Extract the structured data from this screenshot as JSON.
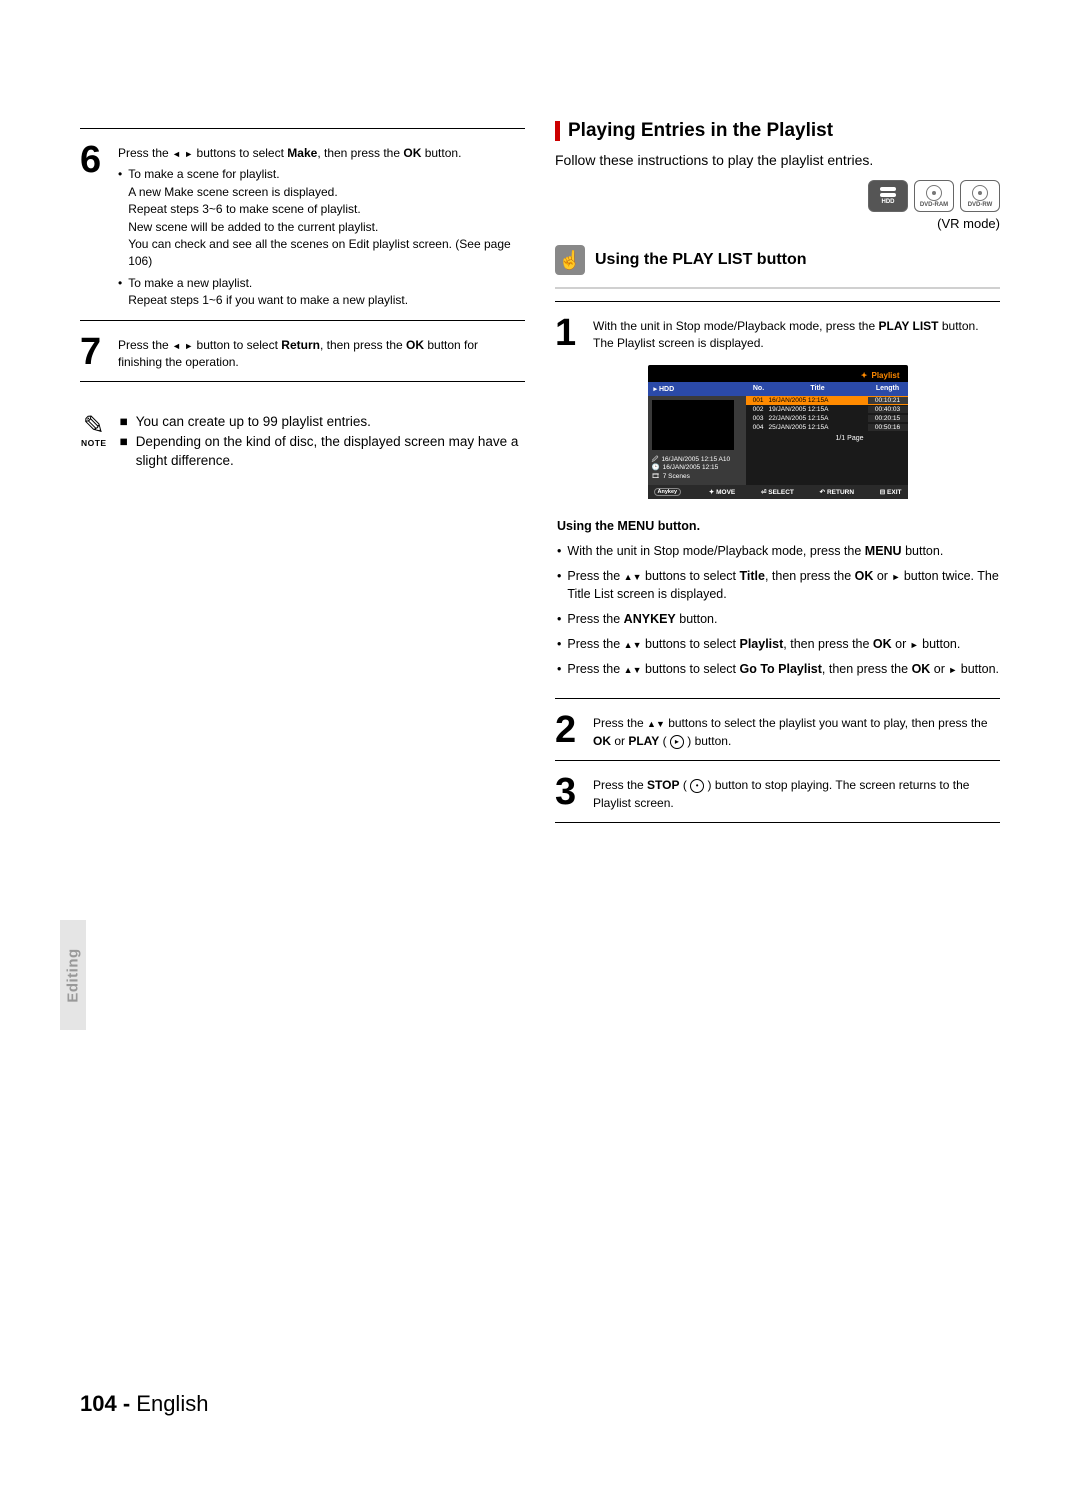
{
  "left": {
    "step6": {
      "num": "6",
      "text_parts": [
        "Press the ",
        " ",
        " buttons to select ",
        "Make",
        ", then press the ",
        "OK",
        " button."
      ],
      "bullet1_lines": [
        "To make a scene for playlist.",
        "A new Make scene screen is displayed.",
        "Repeat steps 3~6 to make scene of playlist.",
        "New scene will be added to the current playlist.",
        "You can check and see all the scenes on Edit playlist screen. (See page 106)"
      ],
      "bullet2_lines": [
        "To make a new playlist.",
        "Repeat steps 1~6 if you want to make a new playlist."
      ]
    },
    "step7": {
      "num": "7",
      "text_parts": [
        "Press the ",
        " ",
        " button to select ",
        "Return",
        ", then press the ",
        "OK",
        " button for finishing the operation."
      ]
    },
    "note": {
      "label": "NOTE",
      "items": [
        "You can create up to 99 playlist entries.",
        "Depending on the kind of disc, the displayed screen may have a slight difference."
      ]
    }
  },
  "right": {
    "title": "Playing Entries in the Playlist",
    "intro": "Follow these instructions to play the playlist entries.",
    "media": {
      "hdd": "HDD",
      "ram": "DVD-RAM",
      "rw": "DVD-RW"
    },
    "vr_mode": "(VR mode)",
    "subhead": "Using the PLAY LIST button",
    "step1": {
      "num": "1",
      "line1_parts": [
        "With the unit in Stop mode/Playback mode, press the ",
        "PLAY LIST",
        " button."
      ],
      "line2": "The Playlist screen is displayed."
    },
    "osd": {
      "title": "Playlist",
      "left_label": "HDD",
      "cols": {
        "no": "No.",
        "title": "Title",
        "length": "Length"
      },
      "rows": [
        {
          "no": "001",
          "title": "16/JAN/2005 12:15A",
          "length": "00:10:21"
        },
        {
          "no": "002",
          "title": "19/JAN/2005 12:15A",
          "length": "00:40:03"
        },
        {
          "no": "003",
          "title": "22/JAN/2005 12:15A",
          "length": "00:20:15"
        },
        {
          "no": "004",
          "title": "25/JAN/2005 12:15A",
          "length": "00:50:16"
        }
      ],
      "meta1": "16/JAN/2005 12:15 A10",
      "meta2": "16/JAN/2005 12:15",
      "meta3": "7 Scenes",
      "page": "1/1  Page",
      "footer": {
        "anykey": "Anykey",
        "move": "MOVE",
        "select": "SELECT",
        "return": "RETURN",
        "exit": "EXIT"
      }
    },
    "menu": {
      "head": "Using the MENU button.",
      "b1": [
        "With the unit in Stop mode/Playback mode, press the ",
        "MENU",
        " button."
      ],
      "b2": [
        "Press the ",
        " buttons to select ",
        "Title",
        ", then press the ",
        "OK",
        " or ",
        " button twice. The Title List screen is displayed."
      ],
      "b3": [
        "Press the ",
        "ANYKEY",
        " button."
      ],
      "b4": [
        "Press the ",
        " buttons to select ",
        "Playlist",
        ", then press the ",
        "OK",
        " or ",
        " button."
      ],
      "b5": [
        "Press the ",
        " buttons to select ",
        "Go To Playlist",
        ", then press the ",
        "OK",
        " or ",
        " button."
      ]
    },
    "step2": {
      "num": "2",
      "parts": [
        "Press the ",
        " buttons to select the playlist you want to play, then press the ",
        "OK",
        " or ",
        "PLAY",
        " ( ",
        " ) button."
      ]
    },
    "step3": {
      "num": "3",
      "parts": [
        "Press the ",
        "STOP",
        " ( ",
        " )  button to stop playing. The screen returns to the Playlist screen."
      ]
    }
  },
  "chart_data": {
    "type": "table",
    "title": "Playlist",
    "columns": [
      "No.",
      "Title",
      "Length"
    ],
    "rows": [
      [
        "001",
        "16/JAN/2005 12:15A",
        "00:10:21"
      ],
      [
        "002",
        "19/JAN/2005 12:15A",
        "00:40:03"
      ],
      [
        "003",
        "22/JAN/2005 12:15A",
        "00:20:15"
      ],
      [
        "004",
        "25/JAN/2005 12:15A",
        "00:50:16"
      ]
    ]
  },
  "side_label": "Editing",
  "footer": {
    "page_num": "104 -",
    "lang": "English"
  }
}
